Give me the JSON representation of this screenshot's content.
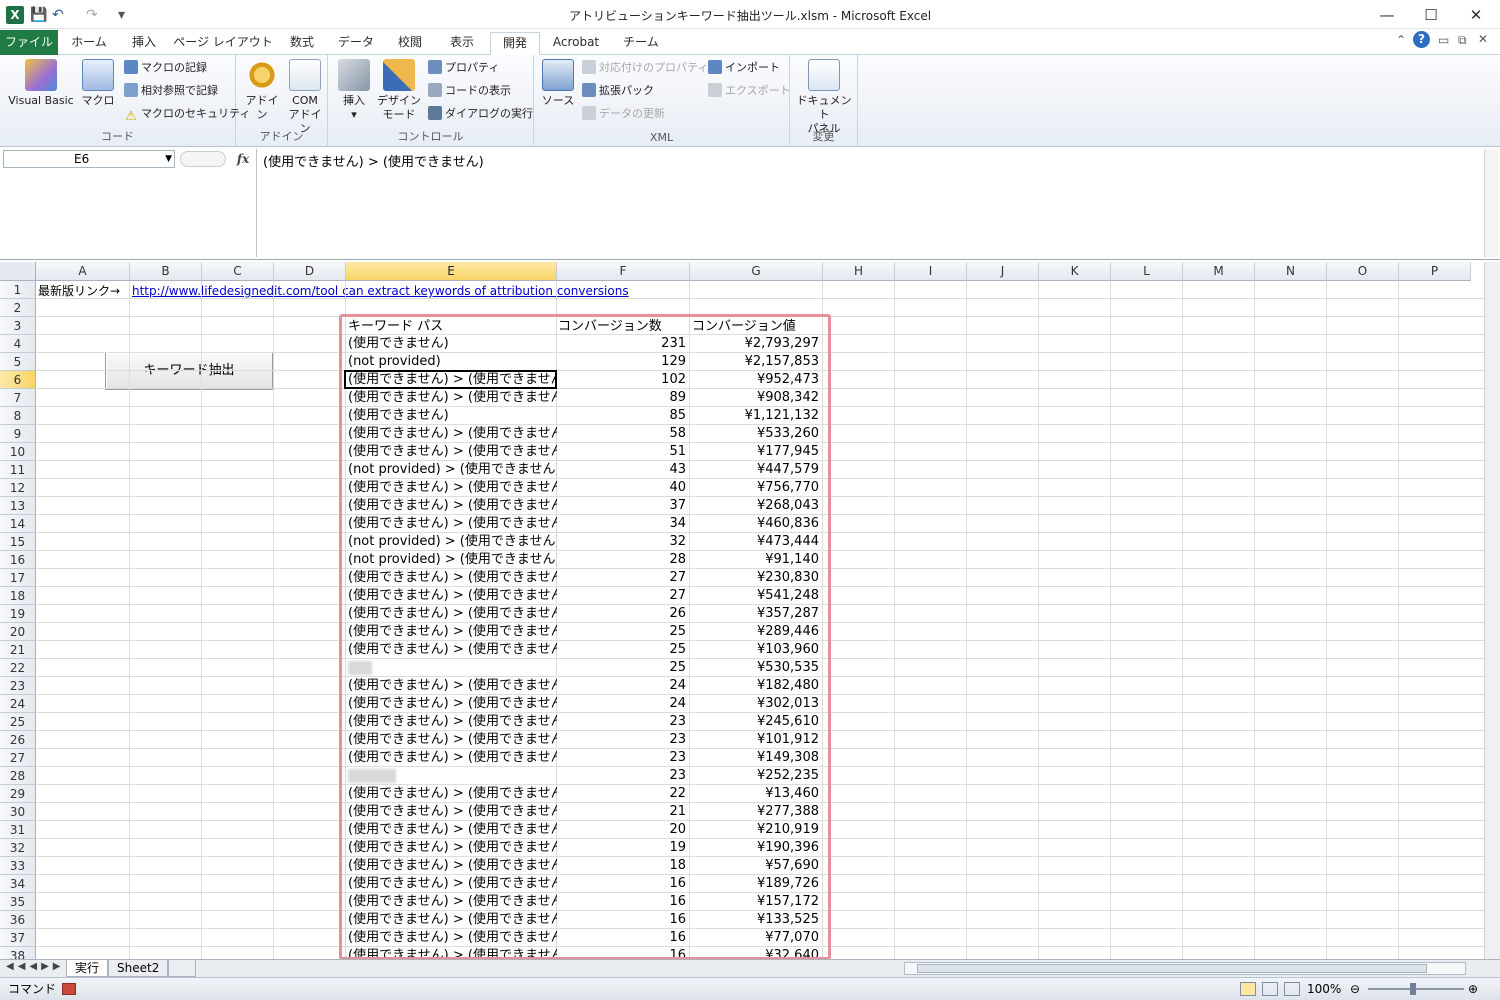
{
  "window": {
    "title": "アトリビューションキーワード抽出ツール.xlsm - Microsoft Excel",
    "app_icon": "X"
  },
  "quick_access": [
    "save-icon",
    "undo-icon",
    "redo-icon",
    "customize-icon"
  ],
  "window_controls": {
    "minimize": "—",
    "maximize": "☐",
    "close": "✕"
  },
  "tabs": [
    "ファイル",
    "ホーム",
    "挿入",
    "ページ レイアウト",
    "数式",
    "データ",
    "校閲",
    "表示",
    "開発",
    "Acrobat",
    "チーム"
  ],
  "ribbon": {
    "code": {
      "label": "コード",
      "visual_basic": "Visual Basic",
      "macro": "マクロ",
      "record_macro": "マクロの記録",
      "relative_ref": "相対参照で記録",
      "macro_security": "マクロのセキュリティ"
    },
    "addins": {
      "label": "アドイン",
      "addin": "アドイン",
      "com1": "COM",
      "com2": "アドイン"
    },
    "controls": {
      "label": "コントロール",
      "insert": "挿入",
      "design1": "デザイン",
      "design2": "モード",
      "properties": "プロパティ",
      "view_code": "コードの表示",
      "run_dialog": "ダイアログの実行"
    },
    "xml": {
      "label": "XML",
      "source": "ソース",
      "map_props": "対応付けのプロパティ",
      "expansion": "拡張パック",
      "refresh": "データの更新",
      "import": "インポート",
      "export": "エクスポート"
    },
    "modify": {
      "label": "変更",
      "doc1": "ドキュメント",
      "doc2": "パネル"
    }
  },
  "formula_bar": {
    "name_box": "E6",
    "fx": "fx",
    "content": "(使用できません) > (使用できません)"
  },
  "columns": [
    "A",
    "B",
    "C",
    "D",
    "E",
    "F",
    "G",
    "H",
    "I",
    "J",
    "K",
    "L",
    "M",
    "N",
    "O",
    "P"
  ],
  "rows_visible": 38,
  "row1": {
    "a1": "最新版リンク→",
    "link": "http://www.lifedesignedit.com/tool can extract keywords of attribution conversions"
  },
  "macro_button": "キーワード抽出",
  "table_header": {
    "keyword": "キーワード パス",
    "conversions": "コンバージョン数",
    "value": "コンバージョン値"
  },
  "rows": [
    {
      "k": "(使用できません)",
      "c": "231",
      "v": "¥2,793,297"
    },
    {
      "k": "(not provided)",
      "c": "129",
      "v": "¥2,157,853"
    },
    {
      "k": "(使用できません) > (使用できません)",
      "c": "102",
      "v": "¥952,473"
    },
    {
      "k": "(使用できません) > (使用できません)",
      "c": "89",
      "v": "¥908,342"
    },
    {
      "k": "(使用できません)",
      "c": "85",
      "v": "¥1,121,132"
    },
    {
      "k": "(使用できません) > (使用できません)",
      "c": "58",
      "v": "¥533,260"
    },
    {
      "k": "(使用できません) > (使用できません)",
      "c": "51",
      "v": "¥177,945"
    },
    {
      "k": "(not provided) > (使用できません)",
      "c": "43",
      "v": "¥447,579"
    },
    {
      "k": "(使用できません) > (使用できません)",
      "c": "40",
      "v": "¥756,770"
    },
    {
      "k": "(使用できません) > (使用できません)",
      "c": "37",
      "v": "¥268,043"
    },
    {
      "k": "(使用できません) > (使用できません)",
      "c": "34",
      "v": "¥460,836"
    },
    {
      "k": "(not provided) > (使用できません)",
      "c": "32",
      "v": "¥473,444"
    },
    {
      "k": "(not provided) > (使用できません)",
      "c": "28",
      "v": "¥91,140"
    },
    {
      "k": "(使用できません) > (使用できません)",
      "c": "27",
      "v": "¥230,830"
    },
    {
      "k": "(使用できません) > (使用できません)",
      "c": "27",
      "v": "¥541,248"
    },
    {
      "k": "(使用できません) > (使用できません)",
      "c": "26",
      "v": "¥357,287"
    },
    {
      "k": "(使用できません) > (使用できません)",
      "c": "25",
      "v": "¥289,446"
    },
    {
      "k": "(使用できません) > (使用できません)",
      "c": "25",
      "v": "¥103,960"
    },
    {
      "k": "",
      "c": "25",
      "v": "¥530,535",
      "blur": 24
    },
    {
      "k": "(使用できません) > (使用できません)",
      "c": "24",
      "v": "¥182,480"
    },
    {
      "k": "(使用できません) > (使用できません)",
      "c": "24",
      "v": "¥302,013"
    },
    {
      "k": "(使用できません) > (使用できません)",
      "c": "23",
      "v": "¥245,610"
    },
    {
      "k": "(使用できません) > (使用できません)",
      "c": "23",
      "v": "¥101,912"
    },
    {
      "k": "(使用できません) > (使用できません)",
      "c": "23",
      "v": "¥149,308"
    },
    {
      "k": "",
      "c": "23",
      "v": "¥252,235",
      "blur": 48
    },
    {
      "k": "(使用できません) > (使用できません)",
      "c": "22",
      "v": "¥13,460"
    },
    {
      "k": "(使用できません) > (使用できません)",
      "c": "21",
      "v": "¥277,388"
    },
    {
      "k": "(使用できません) > (使用できません)",
      "c": "20",
      "v": "¥210,919"
    },
    {
      "k": "(使用できません) > (使用できません)",
      "c": "19",
      "v": "¥190,396"
    },
    {
      "k": "(使用できません) > (使用できません)",
      "c": "18",
      "v": "¥57,690"
    },
    {
      "k": "(使用できません) > (使用できません)",
      "c": "16",
      "v": "¥189,726"
    },
    {
      "k": "(使用できません) > (使用できません)",
      "c": "16",
      "v": "¥157,172"
    },
    {
      "k": "(使用できません) > (使用できません)",
      "c": "16",
      "v": "¥133,525"
    },
    {
      "k": "(使用できません) > (使用できません)",
      "c": "16",
      "v": "¥77,070"
    },
    {
      "k": "(使用できません) > (使用できません)",
      "c": "16",
      "v": "¥32,640"
    }
  ],
  "sheets": [
    "実行",
    "Sheet2"
  ],
  "status": {
    "mode": "コマンド",
    "zoom": "100%"
  },
  "colors": {
    "accent": "#1f7a43",
    "highlight_box": "#e8909a",
    "selected_header": "#f9d466"
  }
}
